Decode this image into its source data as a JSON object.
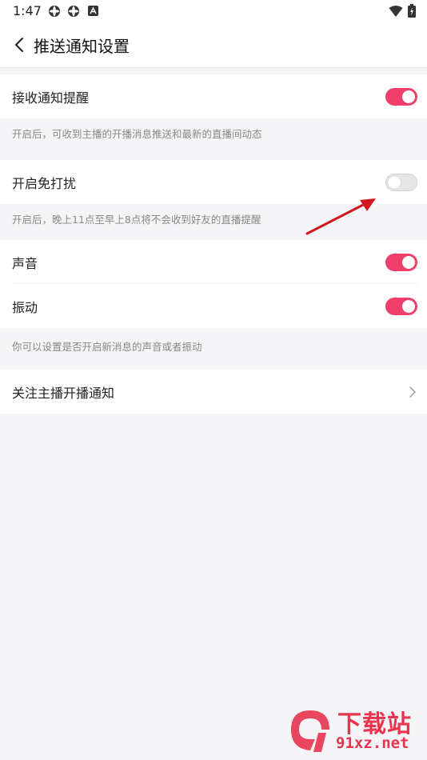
{
  "status_bar": {
    "time": "1:47",
    "left_icons": [
      "gear-icon",
      "gear-icon",
      "accessibility-icon"
    ],
    "right_icons": [
      "wifi-icon",
      "battery-icon"
    ]
  },
  "header": {
    "title": "推送通知设置",
    "back_icon": "chevron-left-icon"
  },
  "settings": {
    "receive_notifications": {
      "label": "接收通知提醒",
      "enabled": true,
      "hint": "开启后，可收到主播的开播消息推送和最新的直播间动态"
    },
    "do_not_disturb": {
      "label": "开启免打扰",
      "enabled": false,
      "hint": "开启后，晚上11点至早上8点将不会收到好友的直播提醒"
    },
    "sound": {
      "label": "声音",
      "enabled": true
    },
    "vibration": {
      "label": "振动",
      "enabled": true
    },
    "sound_vibration_hint": "你可以设置是否开启新消息的声音或者振动",
    "follow_streamer": {
      "label": "关注主播开播通知"
    }
  },
  "watermark": {
    "text_main": "下载站",
    "text_domain": "91xz.net"
  },
  "colors": {
    "accent": "#f03f6a",
    "toggle_off": "#e6e6e8",
    "background": "#f5f5f7",
    "hint_text": "#888888",
    "annotation_arrow": "#d0181e"
  }
}
